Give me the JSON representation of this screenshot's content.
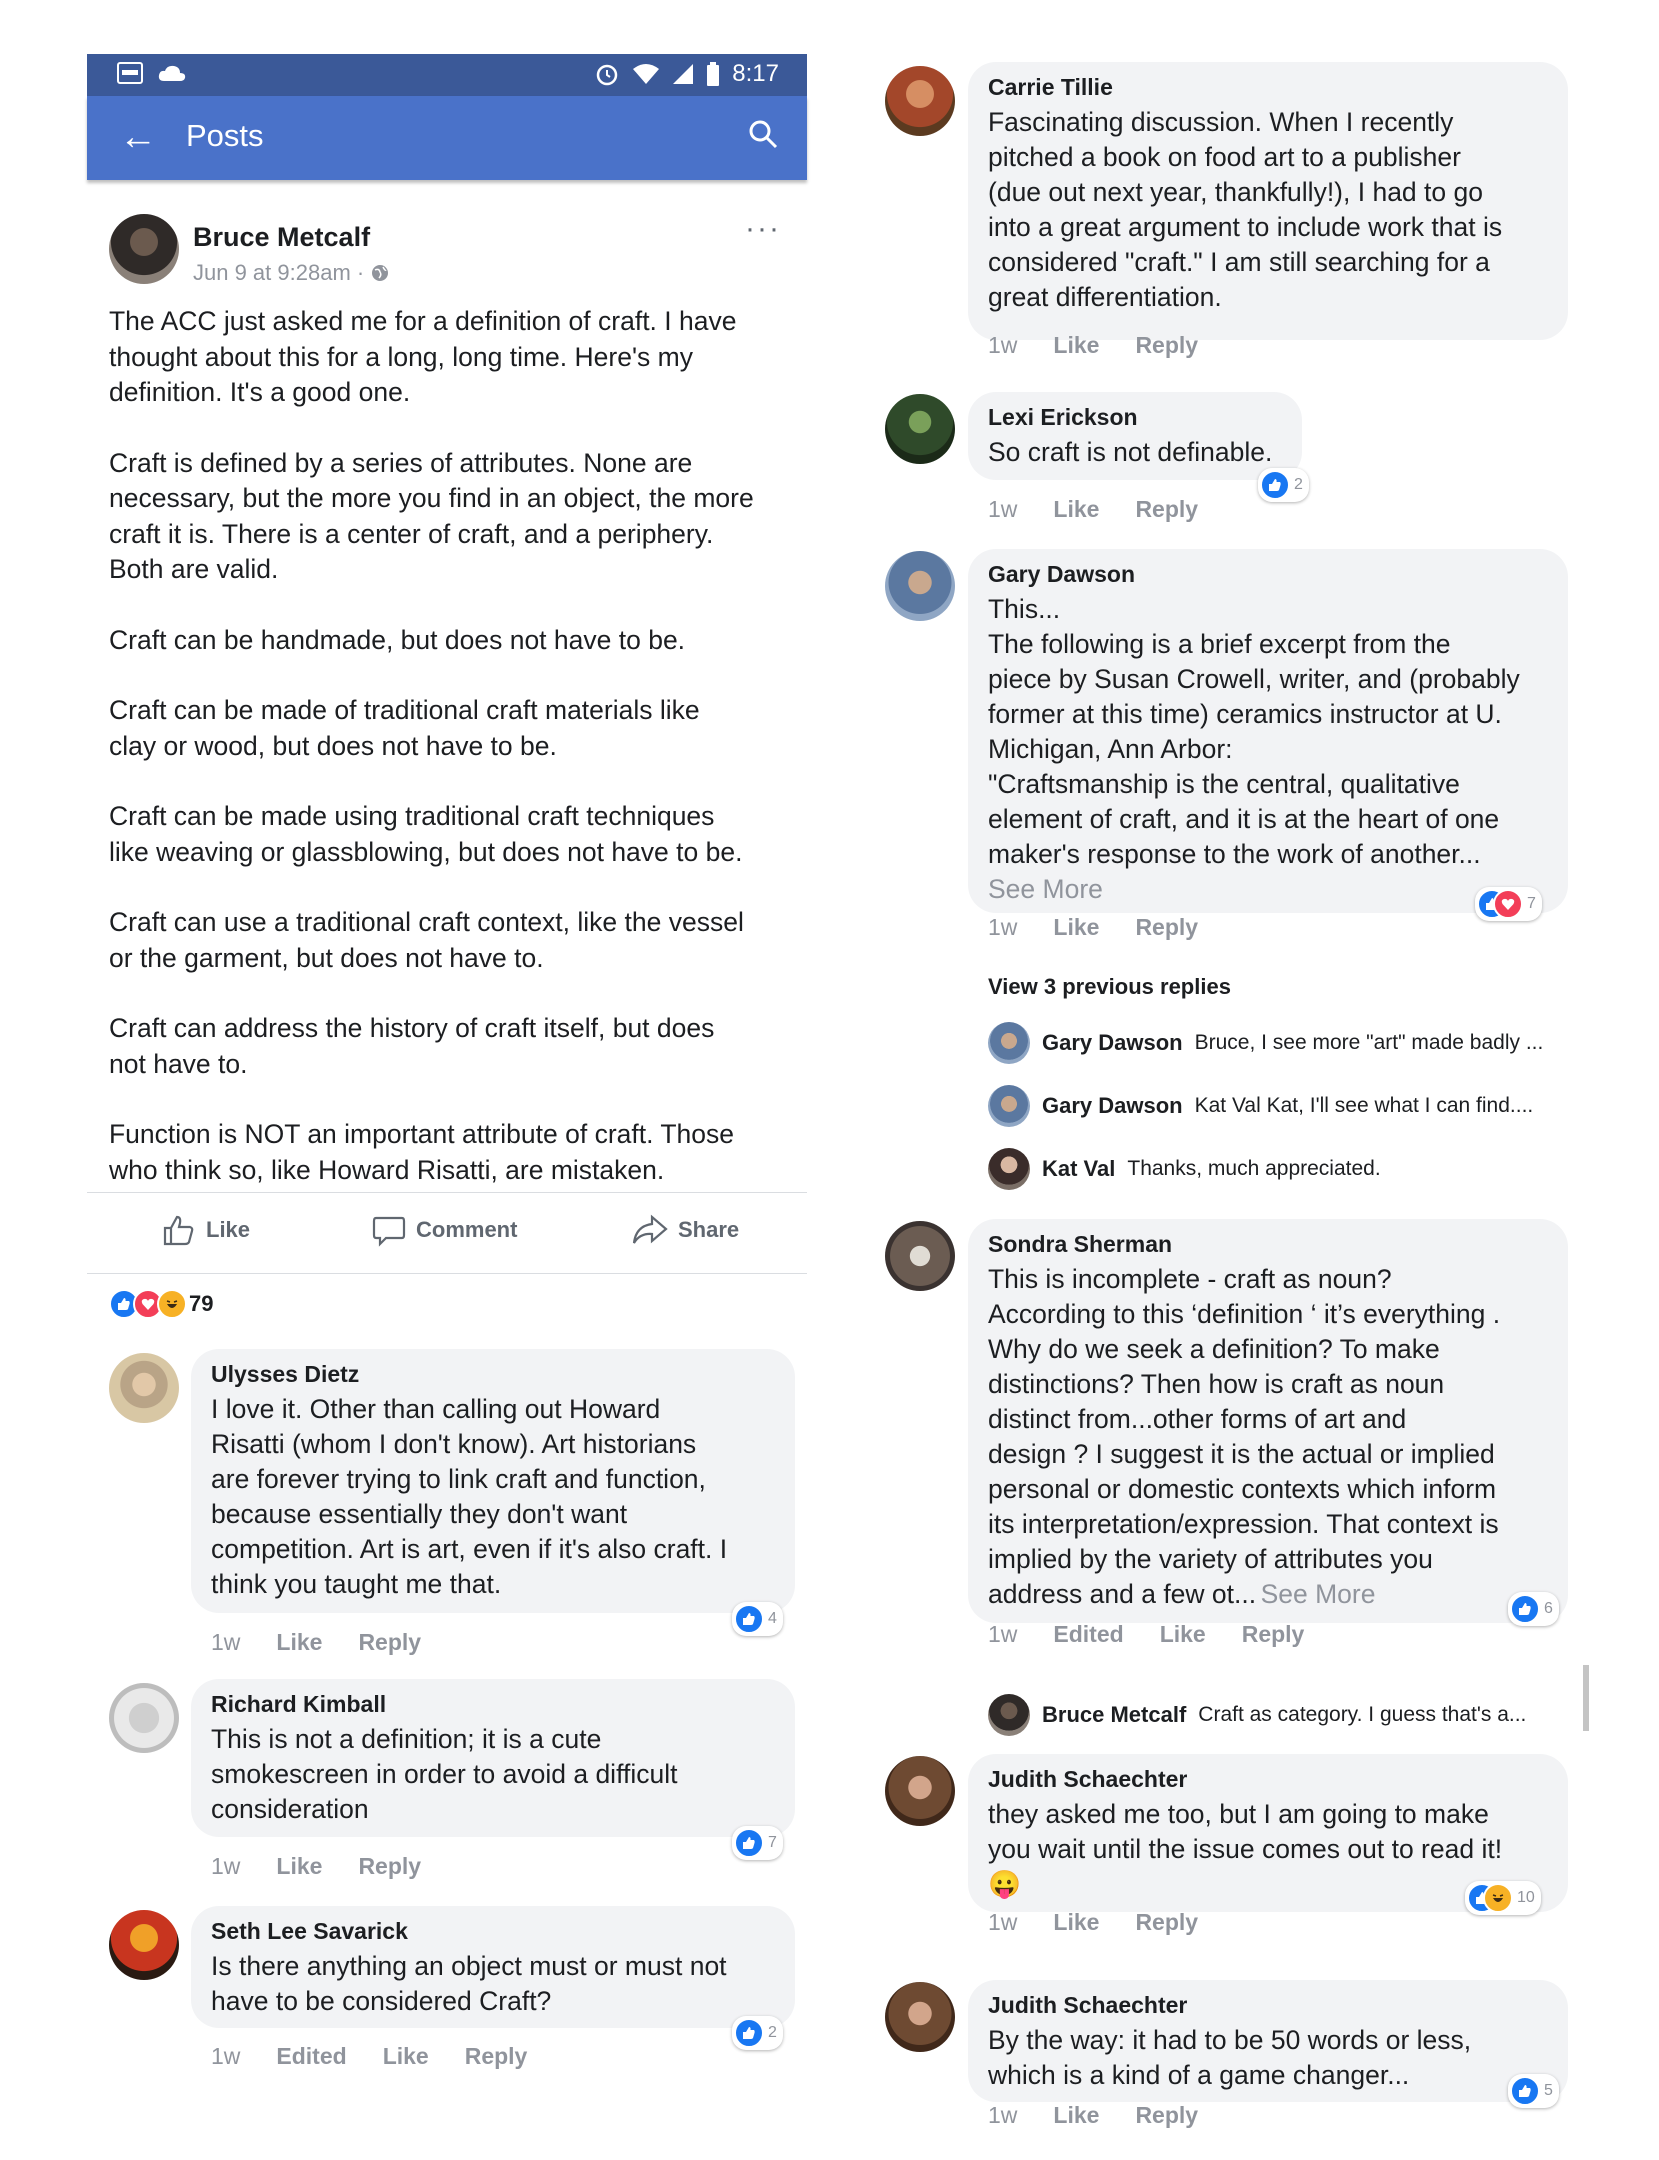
{
  "status_bar": {
    "time": "8:17"
  },
  "app_bar": {
    "title": "Posts"
  },
  "post": {
    "author": "Bruce Metcalf",
    "meta": "Jun 9 at 9:28am",
    "paragraphs": [
      "The ACC just asked me for a definition of craft. I have\nthought about this for a long, long time. Here's my\ndefinition. It's a good one.",
      "Craft is defined by a series of attributes. None are\nnecessary, but the more you find in an object, the more\ncraft it is. There is a center of craft, and a periphery.\nBoth are valid.",
      "Craft can be handmade, but does not have to be.",
      "Craft can be made of traditional craft materials like\nclay or wood, but does not have to be.",
      "Craft can be made using traditional craft techniques\nlike weaving or glassblowing, but does not have to be.",
      "Craft can use a traditional craft context, like the vessel\nor the garment, but does not have to.",
      "Craft can address the history of craft itself, but does\nnot have to.",
      "Function is NOT an important attribute of craft. Those\nwho think so, like Howard Risatti, are mistaken."
    ],
    "actions": {
      "like": "Like",
      "comment": "Comment",
      "share": "Share"
    },
    "reaction_count": "79"
  },
  "comments_left": [
    {
      "name": "Ulysses Dietz",
      "text": "I love it. Other than calling out Howard\nRisatti (whom I don't know). Art historians\nare forever trying to link craft and function,\nbecause essentially they don't want\ncompetition. Art is art, even if it's also craft. I\nthink you taught me that.",
      "time": "1w",
      "like": "Like",
      "reply": "Reply",
      "reactions": "4"
    },
    {
      "name": "Richard Kimball",
      "text": "This is not a definition; it is a cute\nsmokescreen in order to avoid a difficult\nconsideration",
      "time": "1w",
      "like": "Like",
      "reply": "Reply",
      "reactions": "7"
    },
    {
      "name": "Seth Lee Savarick",
      "text": "Is there anything an object must or must not\nhave to be considered Craft?",
      "time": "1w",
      "edited": "Edited",
      "like": "Like",
      "reply": "Reply",
      "reactions": "2"
    }
  ],
  "comments_right": [
    {
      "name": "Carrie Tillie",
      "text": "Fascinating discussion. When I recently\npitched a book on food art to a publisher\n(due out next year, thankfully!), I had to go\ninto a great argument to include work that is\nconsidered \"craft.\" I am still searching for a\ngreat differentiation.",
      "time": "1w",
      "like": "Like",
      "reply": "Reply"
    },
    {
      "name": "Lexi Erickson",
      "text": "So craft is not definable.",
      "time": "1w",
      "like": "Like",
      "reply": "Reply",
      "reactions": "2"
    },
    {
      "name": "Gary Dawson",
      "text": "This...\n The following is a brief excerpt from the\npiece by Susan Crowell, writer, and (probably\nformer at this time) ceramics instructor at U.\nMichigan, Ann Arbor:\n\"Craftsmanship is the central, qualitative\nelement of craft, and it is at the heart of one\nmaker's response to the work of another...",
      "see_more": "See More",
      "time": "1w",
      "like": "Like",
      "reply": "Reply",
      "reactions": "7"
    },
    {
      "name": "Sondra Sherman",
      "text": "This is incomplete - craft as noun?\nAccording to this ‘definition ‘ it’s everything .\nWhy do we seek a definition? To make\ndistinctions? Then how is craft as noun\ndistinct from...other forms of art and\ndesign ? I suggest it is the actual or implied\npersonal or domestic contexts which inform\nits interpretation/expression. That context is\nimplied by the variety of attributes you\naddress and a few ot...",
      "see_more": "See More",
      "time": "1w",
      "edited": "Edited",
      "like": "Like",
      "reply": "Reply",
      "reactions": "6"
    },
    {
      "name": "Judith Schaechter",
      "text": "they asked me too, but I am going to make\nyou wait until the issue comes out to read it!",
      "emoji": "😛",
      "time": "1w",
      "like": "Like",
      "reply": "Reply",
      "reactions": "10"
    },
    {
      "name": "Judith Schaechter",
      "text": "By the way: it had to be 50 words or less,\nwhich is a kind of a game changer...",
      "time": "1w",
      "like": "Like",
      "reply": "Reply",
      "reactions": "5"
    }
  ],
  "view_previous": "View 3 previous replies",
  "replies_gary": [
    {
      "name": "Gary Dawson",
      "text": "Bruce, I see more \"art\" made badly ..."
    },
    {
      "name": "Gary Dawson",
      "text": "Kat Val Kat, I'll see what I can find...."
    },
    {
      "name": "Kat Val",
      "text": "Thanks, much appreciated."
    }
  ],
  "reply_sondra": {
    "name": "Bruce Metcalf",
    "text": "Craft as category. I guess that's a..."
  }
}
